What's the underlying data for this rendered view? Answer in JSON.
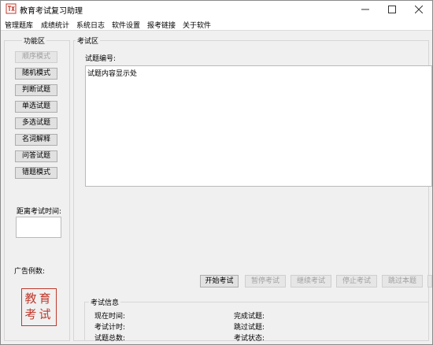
{
  "window": {
    "title": "教育考试复习助理"
  },
  "menu": {
    "items": [
      {
        "label": "管理题库"
      },
      {
        "label": "成绩统计"
      },
      {
        "label": "系统日志"
      },
      {
        "label": "软件设置"
      },
      {
        "label": "报考链接"
      },
      {
        "label": "关于软件"
      }
    ]
  },
  "function_panel": {
    "title": "功能区",
    "buttons": [
      {
        "label": "顺序模式",
        "enabled": false
      },
      {
        "label": "随机模式",
        "enabled": true
      },
      {
        "label": "判断试题",
        "enabled": true
      },
      {
        "label": "单选试题",
        "enabled": true
      },
      {
        "label": "多选试题",
        "enabled": true
      },
      {
        "label": "名词解释",
        "enabled": true
      },
      {
        "label": "问答试题",
        "enabled": true
      },
      {
        "label": "错题模式",
        "enabled": true
      }
    ],
    "countdown_label": "距离考试时间:",
    "countdown_value": "",
    "ad_label": "广告例数:",
    "seal_text": "教育考试"
  },
  "exam_panel": {
    "title": "考试区",
    "question_id_label": "试题编号:",
    "content_text": "试题内容显示处",
    "controls": [
      {
        "label": "开始考试",
        "enabled": true
      },
      {
        "label": "暂停考试",
        "enabled": false
      },
      {
        "label": "继续考试",
        "enabled": false
      },
      {
        "label": "停止考试",
        "enabled": false
      },
      {
        "label": "跳过本题",
        "enabled": false
      }
    ]
  },
  "exam_info": {
    "title": "考试信息",
    "current_time_label": "现在时间:",
    "timer_label": "考试计时:",
    "total_label": "试题总数:",
    "completed_label": "完成试题:",
    "skipped_label": "跳过试题:",
    "status_label": "考试状态:"
  },
  "colors": {
    "window_bg": "#f0f0f0",
    "seal": "#c0392b"
  }
}
